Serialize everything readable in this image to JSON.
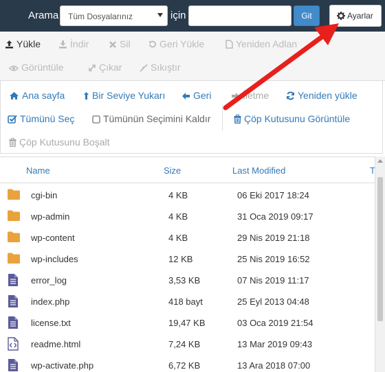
{
  "search": {
    "label": "Arama",
    "scope_selected": "Tüm Dosyalarınız",
    "for_label": "için",
    "query_value": "",
    "go_label": "Git",
    "settings_label": "Ayarlar"
  },
  "toolbar": {
    "upload": "Yükle",
    "download": "İndir",
    "delete": "Sil",
    "restore": "Geri Yükle",
    "rename": "Yeniden Adlan",
    "view": "Görüntüle",
    "extract": "Çıkar",
    "compress": "Sıkıştır"
  },
  "actions": {
    "home": "Ana sayfa",
    "up_level": "Bir Seviye Yukarı",
    "back": "Geri",
    "forward": "İletme",
    "reload": "Yeniden yükle",
    "select_all": "Tümünü Seç",
    "unselect_all": "Tümünün Seçimini Kaldır",
    "view_trash": "Çöp Kutusunu Görüntüle",
    "empty_trash": "Çöp Kutusunu Boşalt"
  },
  "table": {
    "headers": {
      "name": "Name",
      "size": "Size",
      "modified": "Last Modified",
      "type": "Typ"
    },
    "rows": [
      {
        "icon": "folder-icon",
        "name": "cgi-bin",
        "size": "4 KB",
        "modified": "06 Eki 2017 18:24"
      },
      {
        "icon": "folder-icon",
        "name": "wp-admin",
        "size": "4 KB",
        "modified": "31 Oca 2019 09:17"
      },
      {
        "icon": "folder-icon",
        "name": "wp-content",
        "size": "4 KB",
        "modified": "29 Nis 2019 21:18"
      },
      {
        "icon": "folder-icon",
        "name": "wp-includes",
        "size": "12 KB",
        "modified": "25 Nis 2019 16:52"
      },
      {
        "icon": "text-file-icon",
        "name": "error_log",
        "size": "3,53 KB",
        "modified": "07 Nis 2019 11:17"
      },
      {
        "icon": "text-file-icon",
        "name": "index.php",
        "size": "418 bayt",
        "modified": "25 Eyl 2013 04:48"
      },
      {
        "icon": "text-file-icon",
        "name": "license.txt",
        "size": "19,47 KB",
        "modified": "03 Oca 2019 21:54"
      },
      {
        "icon": "code-file-icon",
        "name": "readme.html",
        "size": "7,24 KB",
        "modified": "13 Mar 2019 09:43"
      },
      {
        "icon": "text-file-icon",
        "name": "wp-activate.php",
        "size": "6,72 KB",
        "modified": "13 Ara 2018 07:00"
      }
    ]
  },
  "colors": {
    "topbar": "#293a4a",
    "link": "#337ab7",
    "go_button": "#428bca",
    "folder": "#e8a33d",
    "file": "#5b5b9a",
    "annotation_arrow": "#e8201c"
  }
}
